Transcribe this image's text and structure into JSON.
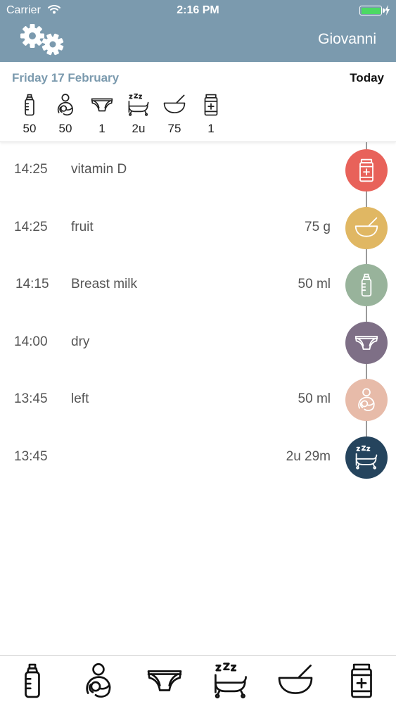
{
  "status_bar": {
    "carrier": "Carrier",
    "time": "2:16 PM"
  },
  "nav": {
    "user_name": "Giovanni"
  },
  "summary": {
    "date": "Friday 17 February",
    "today_label": "Today",
    "items": [
      {
        "icon": "bottle-icon",
        "value": "50"
      },
      {
        "icon": "breastfeeding-icon",
        "value": "50"
      },
      {
        "icon": "diaper-icon",
        "value": "1"
      },
      {
        "icon": "sleep-crib-icon",
        "value": "2u"
      },
      {
        "icon": "food-bowl-icon",
        "value": "75"
      },
      {
        "icon": "medicine-icon",
        "value": "1"
      }
    ]
  },
  "timeline": [
    {
      "time": "14:25",
      "label": "vitamin D",
      "amount": "",
      "icon": "medicine-icon",
      "color": "#e8625a"
    },
    {
      "time": "14:25",
      "label": "fruit",
      "amount": "75 g",
      "icon": "food-bowl-icon",
      "color": "#e0b763"
    },
    {
      "time": "14:15",
      "label": "Breast milk",
      "amount": "50 ml",
      "icon": "bottle-icon",
      "color": "#98b39b"
    },
    {
      "time": "14:00",
      "label": "dry",
      "amount": "",
      "icon": "diaper-icon",
      "color": "#7e6f86"
    },
    {
      "time": "13:45",
      "label": "left",
      "amount": "50 ml",
      "icon": "breastfeeding-icon",
      "color": "#e7bba9"
    },
    {
      "time": "13:45",
      "label": "",
      "amount": "2u 29m",
      "icon": "sleep-crib-icon",
      "color": "#25445d"
    }
  ],
  "tab_bar": [
    {
      "icon": "bottle-icon"
    },
    {
      "icon": "breastfeeding-icon"
    },
    {
      "icon": "diaper-icon"
    },
    {
      "icon": "sleep-crib-icon"
    },
    {
      "icon": "food-bowl-icon"
    },
    {
      "icon": "medicine-icon"
    }
  ],
  "colors": {
    "header": "#7b9aae",
    "battery": "#4cd964"
  }
}
